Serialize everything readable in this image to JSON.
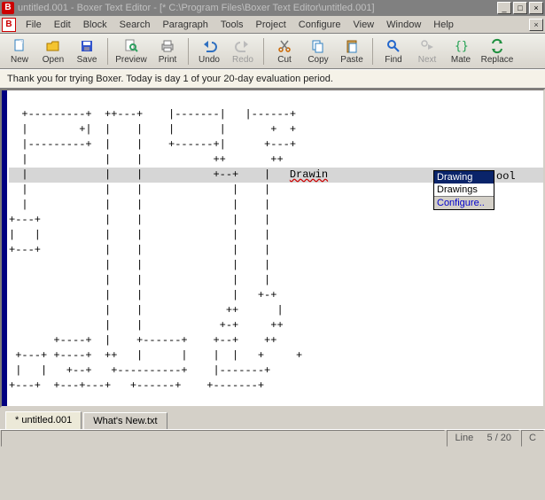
{
  "title": "untitled.001 - Boxer Text Editor - [* C:\\Program Files\\Boxer Text Editor\\untitled.001]",
  "menu": [
    "File",
    "Edit",
    "Block",
    "Search",
    "Paragraph",
    "Tools",
    "Project",
    "Configure",
    "View",
    "Window",
    "Help"
  ],
  "toolbar": {
    "new": "New",
    "open": "Open",
    "save": "Save",
    "preview": "Preview",
    "print": "Print",
    "undo": "Undo",
    "redo": "Redo",
    "cut": "Cut",
    "copy": "Copy",
    "paste": "Paste",
    "find": "Find",
    "next": "Next",
    "mate": "Mate",
    "replace": "Replace"
  },
  "eval_banner": "Thank you for trying Boxer.  Today is day 1 of your 20-day evaluation period.",
  "editor_lines": {
    "l0": "  +---------+  ++---+    |-------|   |------+",
    "l1": "  |        +|  |    |    |       |       +  + ",
    "l2": "  |---------+  |    |    +------+|      +---+",
    "l3": "  |            |    |           ++       ++",
    "l4_a": "  |            |    |           +--+    |   ",
    "l4_b": "Drawin",
    "l5": "  |            |    |              |    |",
    "l6": "  |            |    |              |    |",
    "l7": "+---+          |    |              |    |",
    "l8": "|   |          |    |              |    |",
    "l9": "+---+          |    |              |    |",
    "l10": "               |    |              |    |",
    "l11": "               |    |              |    |",
    "l12": "               |    |              |   +-+",
    "l13": "               |    |             ++      |",
    "l14": "               |    |            +-+     ++",
    "l15": "       +----+  |    +------+    +--+    ++",
    "l16": " +---+ +----+  ++   |      |    |  |   +     +",
    "l17": " |   |   +--+   +----------+    |-------+",
    "l18": "+---+  +---+---+   +------+    +-------+"
  },
  "autocomplete": {
    "items": [
      "Drawing",
      "Drawings"
    ],
    "selected_index": 0,
    "configure_label": "Configure..",
    "trailing_text": "ool"
  },
  "tabs": [
    "* untitled.001",
    "What's New.txt"
  ],
  "active_tab": 0,
  "status": {
    "line_label": "Line",
    "line_value": "5 / 20",
    "mode": "C"
  },
  "colors": {
    "title_inactive": "#808080",
    "gutter": "#000080",
    "selection": "#0a246a"
  }
}
